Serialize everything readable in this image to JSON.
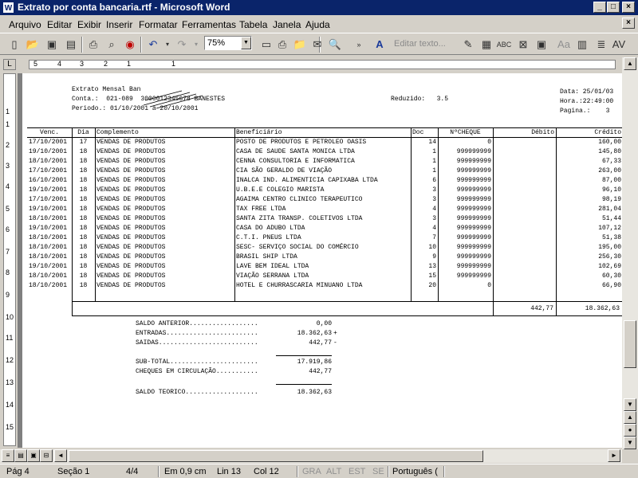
{
  "window": {
    "title": "Extrato por conta bancaria.rtf - Microsoft Word",
    "app_icon": "W"
  },
  "menu": [
    "Arquivo",
    "Editar",
    "Exibir",
    "Inserir",
    "Formatar",
    "Ferramentas",
    "Tabela",
    "Janela",
    "Ajuda"
  ],
  "toolbar": {
    "zoom": "75%",
    "edit_text": "Editar texto..."
  },
  "ruler": {
    "h": [
      "5",
      "4",
      "3",
      "2",
      "1",
      "1"
    ],
    "v": [
      "1",
      "1",
      "2",
      "3",
      "4",
      "5",
      "6",
      "7",
      "8",
      "9",
      "10",
      "11",
      "12",
      "13",
      "14",
      "15"
    ]
  },
  "header": {
    "title": "Extrato Mensal Ban",
    "conta": "Conta.:  021-089  3000012345678 BANESTES",
    "periodo": "Periodo.: 01/10/2001 a 20/10/2001",
    "reduzido": "Reduzido:   3.5",
    "data": "Data: 25/01/03",
    "hora": "Hora.:22:49:00",
    "pagina": "Pagina.:    3"
  },
  "columns": [
    "Venc.",
    "Dia",
    "Complemento",
    "Beneficiário",
    "Doc",
    "NºCHEQUE",
    "Débito",
    "Crédito"
  ],
  "rows": [
    [
      "17/10/2001",
      "17",
      "VENDAS DE PRODUTOS",
      "POSTO DE PRODUTOS E PETROLEO OASIS",
      "14",
      "0",
      "",
      "160,00"
    ],
    [
      "19/10/2001",
      "18",
      "VENDAS DE PRODUTOS",
      "CASA DE SAUDE SANTA MONICA LTDA",
      "1",
      "999999999",
      "",
      "145,80"
    ],
    [
      "18/10/2001",
      "18",
      "VENDAS DE PRODUTOS",
      "CENNA CONSULTORIA E INFORMATICA",
      "1",
      "999999999",
      "",
      "67,33"
    ],
    [
      "17/10/2001",
      "18",
      "VENDAS DE PRODUTOS",
      "CIA SÃO GERALDO DE VIAÇÃO",
      "1",
      "999999999",
      "",
      "263,00"
    ],
    [
      "16/10/2001",
      "18",
      "VENDAS DE PRODUTOS",
      "INALCA IND. ALIMENTICIA CAPIXABA LTDA",
      "6",
      "999999999",
      "",
      "87,00"
    ],
    [
      "19/10/2001",
      "18",
      "VENDAS DE PRODUTOS",
      "U.B.E.E COLEGIO MARISTA",
      "3",
      "999999999",
      "",
      "96,10"
    ],
    [
      "17/10/2001",
      "18",
      "VENDAS DE PRODUTOS",
      "AGAIMA CENTRO CLINICO TERAPEUTICO",
      "3",
      "999999999",
      "",
      "98,19"
    ],
    [
      "19/10/2001",
      "18",
      "VENDAS DE PRODUTOS",
      "TAX FREE LTDA",
      "4",
      "999999999",
      "",
      "281,04"
    ],
    [
      "18/10/2001",
      "18",
      "VENDAS DE PRODUTOS",
      "SANTA ZITA TRANSP. COLETIVOS LTDA",
      "3",
      "999999999",
      "",
      "51,44"
    ],
    [
      "19/10/2001",
      "18",
      "VENDAS DE PRODUTOS",
      "CASA DO ADUBO LTDA",
      "4",
      "999999999",
      "",
      "107,12"
    ],
    [
      "18/10/2001",
      "18",
      "VENDAS DE PRODUTOS",
      "C.T.I. PNEUS LTDA",
      "7",
      "999999999",
      "",
      "51,38"
    ],
    [
      "18/10/2001",
      "18",
      "VENDAS DE PRODUTOS",
      "SESC- SERVIÇO SOCIAL DO COMÉRCIO",
      "10",
      "999999999",
      "",
      "195,00"
    ],
    [
      "18/10/2001",
      "18",
      "VENDAS DE PRODUTOS",
      "BRASIL SHIP LTDA",
      "9",
      "999999999",
      "",
      "256,30"
    ],
    [
      "19/10/2001",
      "18",
      "VENDAS DE PRODUTOS",
      "LAVE BEM IDEAL LTDA",
      "13",
      "999999999",
      "",
      "102,69"
    ],
    [
      "18/10/2001",
      "18",
      "VENDAS DE PRODUTOS",
      "VIAÇÃO SERRANA LTDA",
      "15",
      "999999999",
      "",
      "60,30"
    ],
    [
      "18/10/2001",
      "18",
      "VENDAS DE PRODUTOS",
      "HOTEL E CHURRASCARIA MINUANO LTDA",
      "20",
      "0",
      "",
      "66,90"
    ]
  ],
  "totals": {
    "debito": "442,77",
    "credito": "18.362,63"
  },
  "summary": [
    {
      "label": "SALDO ANTERIOR..................",
      "value": "0,00",
      "sign": ""
    },
    {
      "label": "ENTRADAS........................",
      "value": "18.362,63",
      "sign": "+"
    },
    {
      "label": "SAIDAS..........................",
      "value": "442,77",
      "sign": "-"
    },
    {
      "label": "SUB-TOTAL.......................",
      "value": "17.919,86",
      "sign": ""
    },
    {
      "label": "CHEQUES EM CIRCULAÇÃO...........",
      "value": "442,77",
      "sign": ""
    },
    {
      "label": "SALDO TEORICO...................",
      "value": "18.362,63",
      "sign": ""
    }
  ],
  "status": {
    "page": "Pág 4",
    "section": "Seção 1",
    "pages": "4/4",
    "at": "Em 0,9 cm",
    "line": "Lin 13",
    "col": "Col 12",
    "rec": "GRA",
    "trk": "ALT",
    "ext": "EST",
    "ovr": "SE",
    "lang": "Português ("
  }
}
